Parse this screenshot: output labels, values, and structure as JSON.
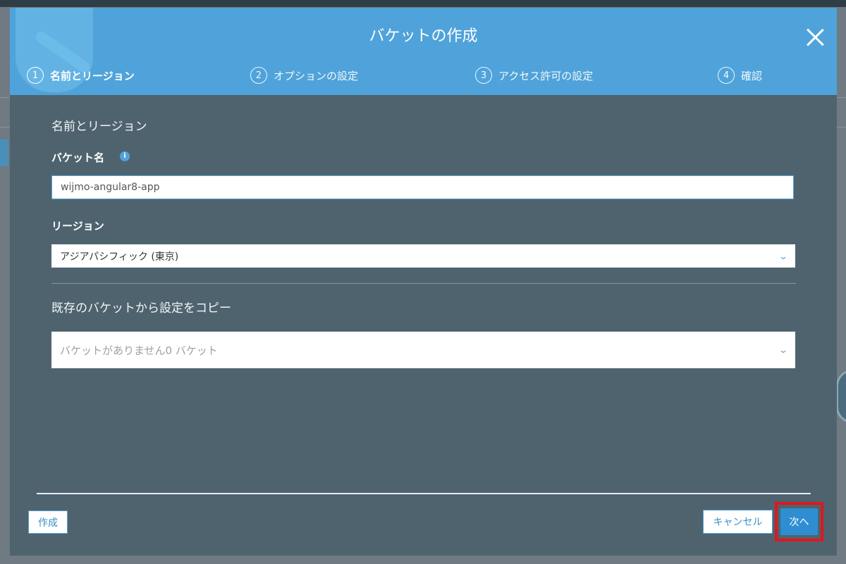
{
  "modal": {
    "title": "バケットの作成",
    "steps": [
      {
        "number": "1",
        "label": "名前とリージョン",
        "active": true
      },
      {
        "number": "2",
        "label": "オプションの設定",
        "active": false
      },
      {
        "number": "3",
        "label": "アクセス許可の設定",
        "active": false
      },
      {
        "number": "4",
        "label": "確認",
        "active": false
      }
    ],
    "section_title": "名前とリージョン",
    "bucket_name": {
      "label": "バケット名",
      "info_icon": "info-icon",
      "value": "wijmo-angular8-app"
    },
    "region": {
      "label": "リージョン",
      "selected": "アジアパシフィック (東京)"
    },
    "copy_settings": {
      "label": "既存のバケットから設定をコピー",
      "placeholder": "バケットがありません0 バケット"
    },
    "buttons": {
      "create": "作成",
      "cancel": "キャンセル",
      "next": "次へ"
    }
  },
  "colors": {
    "header": "#4fa3da",
    "body": "#4f636f",
    "accent": "#2f8ed1",
    "highlight": "#e0161e"
  }
}
